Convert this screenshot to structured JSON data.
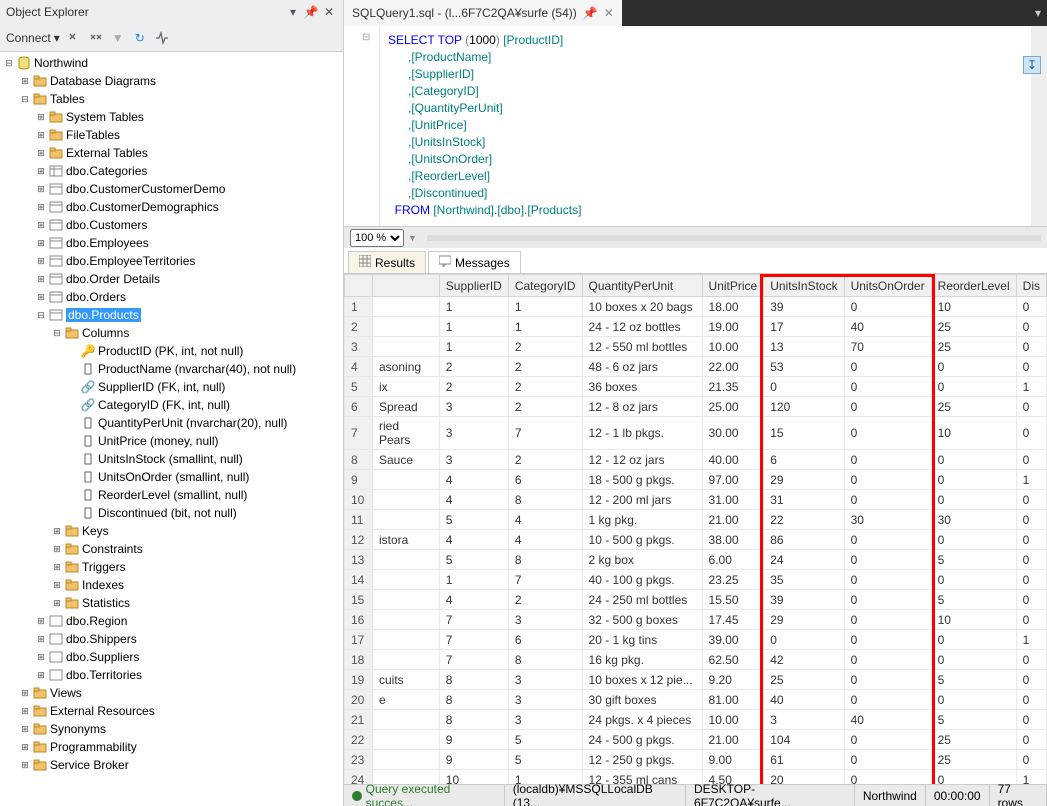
{
  "explorer": {
    "title": "Object Explorer",
    "connect_label": "Connect",
    "root": "Northwind",
    "db_diagrams": "Database Diagrams",
    "tables": "Tables",
    "system_tables": "System Tables",
    "file_tables": "FileTables",
    "external_tables": "External Tables",
    "cat": "dbo.Categories",
    "custcust": "dbo.CustomerCustomerDemo",
    "custdemo": "dbo.CustomerDemographics",
    "customers": "dbo.Customers",
    "employees": "dbo.Employees",
    "empterr": "dbo.EmployeeTerritories",
    "orderdet": "dbo.Order Details",
    "orders": "dbo.Orders",
    "products": "dbo.Products",
    "columns": "Columns",
    "col_productid": "ProductID (PK, int, not null)",
    "col_productname": "ProductName (nvarchar(40), not null)",
    "col_supplierid": "SupplierID (FK, int, null)",
    "col_categoryid": "CategoryID (FK, int, null)",
    "col_qpu": "QuantityPerUnit (nvarchar(20), null)",
    "col_unitprice": "UnitPrice (money, null)",
    "col_unitsinstock": "UnitsInStock (smallint, null)",
    "col_unitsonorder": "UnitsOnOrder (smallint, null)",
    "col_reorderlevel": "ReorderLevel (smallint, null)",
    "col_discontinued": "Discontinued (bit, not null)",
    "keys": "Keys",
    "constraints": "Constraints",
    "triggers": "Triggers",
    "indexes": "Indexes",
    "statistics": "Statistics",
    "region": "dbo.Region",
    "shippers": "dbo.Shippers",
    "suppliers": "dbo.Suppliers",
    "territories": "dbo.Territories",
    "views": "Views",
    "ext_res": "External Resources",
    "synonyms": "Synonyms",
    "programmability": "Programmability",
    "service_broker": "Service Broker"
  },
  "tab": {
    "title": "SQLQuery1.sql - (l...6F7C2QA¥surfe (54))"
  },
  "code": {
    "l1a": "SELECT",
    "l1b": " TOP ",
    "l1c": "(",
    "l1d": "1000",
    "l1e": ") ",
    "l1f": "[ProductID]",
    "l2": "      ,[ProductName]",
    "l3": "      ,[SupplierID]",
    "l4": "      ,[CategoryID]",
    "l5": "      ,[QuantityPerUnit]",
    "l6": "      ,[UnitPrice]",
    "l7": "      ,[UnitsInStock]",
    "l8": "      ,[UnitsOnOrder]",
    "l9": "      ,[ReorderLevel]",
    "l10": "      ,[Discontinued]",
    "l11a": "  FROM ",
    "l11b": "[Northwind].[dbo].[Products]"
  },
  "zoom": "100 %",
  "tabs2": {
    "results": "Results",
    "messages": "Messages"
  },
  "grid": {
    "headers": [
      "",
      "SupplierID",
      "CategoryID",
      "QuantityPerUnit",
      "UnitPrice",
      "UnitsInStock",
      "UnitsOnOrder",
      "ReorderLevel",
      "Dis"
    ],
    "rows": [
      [
        "",
        "1",
        "1",
        "10 boxes x 20 bags",
        "18.00",
        "39",
        "0",
        "10",
        "0"
      ],
      [
        "",
        "1",
        "1",
        "24 - 12 oz bottles",
        "19.00",
        "17",
        "40",
        "25",
        "0"
      ],
      [
        "",
        "1",
        "2",
        "12 - 550 ml bottles",
        "10.00",
        "13",
        "70",
        "25",
        "0"
      ],
      [
        "asoning",
        "2",
        "2",
        "48 - 6 oz jars",
        "22.00",
        "53",
        "0",
        "0",
        "0"
      ],
      [
        "ix",
        "2",
        "2",
        "36 boxes",
        "21.35",
        "0",
        "0",
        "0",
        "1"
      ],
      [
        " Spread",
        "3",
        "2",
        "12 - 8 oz jars",
        "25.00",
        "120",
        "0",
        "25",
        "0"
      ],
      [
        "ried Pears",
        "3",
        "7",
        "12 - 1 lb pkgs.",
        "30.00",
        "15",
        "0",
        "10",
        "0"
      ],
      [
        " Sauce",
        "3",
        "2",
        "12 - 12 oz jars",
        "40.00",
        "6",
        "0",
        "0",
        "0"
      ],
      [
        "",
        "4",
        "6",
        "18 - 500 g pkgs.",
        "97.00",
        "29",
        "0",
        "0",
        "1"
      ],
      [
        "",
        "4",
        "8",
        "12 - 200 ml jars",
        "31.00",
        "31",
        "0",
        "0",
        "0"
      ],
      [
        "",
        "5",
        "4",
        "1 kg pkg.",
        "21.00",
        "22",
        "30",
        "30",
        "0"
      ],
      [
        "istora",
        "4",
        "4",
        "10 - 500 g pkgs.",
        "38.00",
        "86",
        "0",
        "0",
        "0"
      ],
      [
        "",
        "5",
        "8",
        "2 kg box",
        "6.00",
        "24",
        "0",
        "5",
        "0"
      ],
      [
        "",
        "1",
        "7",
        "40 - 100 g pkgs.",
        "23.25",
        "35",
        "0",
        "0",
        "0"
      ],
      [
        "",
        "4",
        "2",
        "24 - 250 ml bottles",
        "15.50",
        "39",
        "0",
        "5",
        "0"
      ],
      [
        "",
        "7",
        "3",
        "32 - 500 g boxes",
        "17.45",
        "29",
        "0",
        "10",
        "0"
      ],
      [
        "",
        "7",
        "6",
        "20 - 1 kg tins",
        "39.00",
        "0",
        "0",
        "0",
        "1"
      ],
      [
        "",
        "7",
        "8",
        "16 kg pkg.",
        "62.50",
        "42",
        "0",
        "0",
        "0"
      ],
      [
        "cuits",
        "8",
        "3",
        "10 boxes x 12 pie...",
        "9.20",
        "25",
        "0",
        "5",
        "0"
      ],
      [
        "e",
        "8",
        "3",
        "30 gift boxes",
        "81.00",
        "40",
        "0",
        "0",
        "0"
      ],
      [
        "",
        "8",
        "3",
        "24 pkgs. x 4 pieces",
        "10.00",
        "3",
        "40",
        "5",
        "0"
      ],
      [
        "",
        "9",
        "5",
        "24 - 500 g pkgs.",
        "21.00",
        "104",
        "0",
        "25",
        "0"
      ],
      [
        "",
        "9",
        "5",
        "12 - 250 g pkgs.",
        "9.00",
        "61",
        "0",
        "25",
        "0"
      ],
      [
        "",
        "10",
        "1",
        "12 - 355 ml cans",
        "4.50",
        "20",
        "0",
        "0",
        "1"
      ]
    ]
  },
  "status": {
    "success": "Query executed succes...",
    "server": "(localdb)¥MSSQLLocalDB (13...",
    "user": "DESKTOP-6F7C2QA¥surfe...",
    "db": "Northwind",
    "time": "00:00:00",
    "rows": "77 rows"
  }
}
